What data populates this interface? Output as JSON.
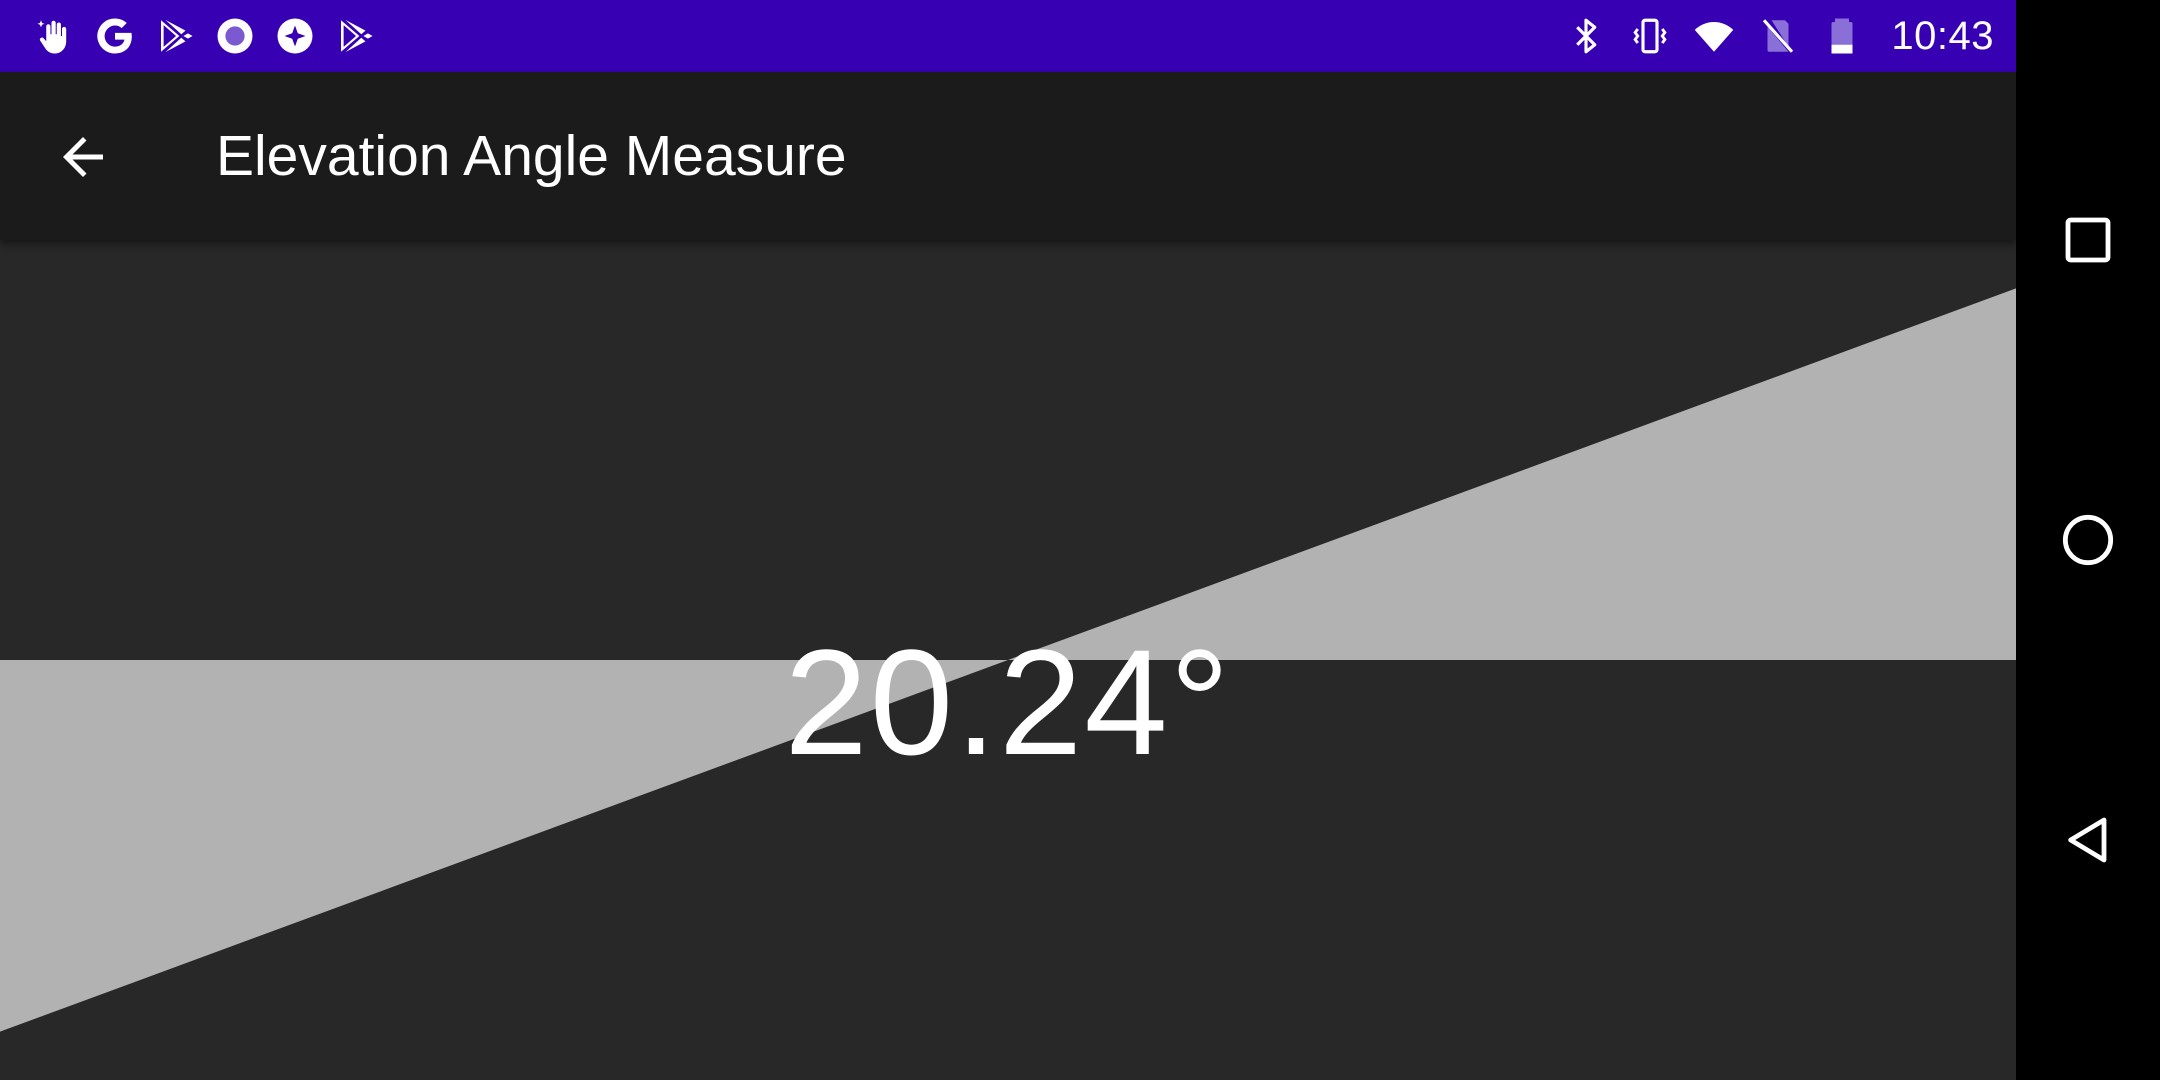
{
  "status_bar": {
    "time": "10:43",
    "background": "#3700b3",
    "left_icons": [
      "gesture-icon",
      "google-icon",
      "play-store-icon",
      "record-icon",
      "app-diamond-icon",
      "play-store-icon"
    ],
    "right_icons": [
      "bluetooth-icon",
      "vibrate-icon",
      "wifi-icon",
      "no-sim-icon",
      "battery-icon"
    ]
  },
  "app_bar": {
    "title": "Elevation Angle Measure",
    "back_icon": "arrow-back-icon"
  },
  "level": {
    "angle_text": "20.24°",
    "angle_degrees": 20.24,
    "fill_color": "#b2b2b2",
    "background_color": "#282828"
  },
  "nav_bar": {
    "buttons": [
      "recents-icon",
      "home-icon",
      "back-triangle-icon"
    ]
  }
}
